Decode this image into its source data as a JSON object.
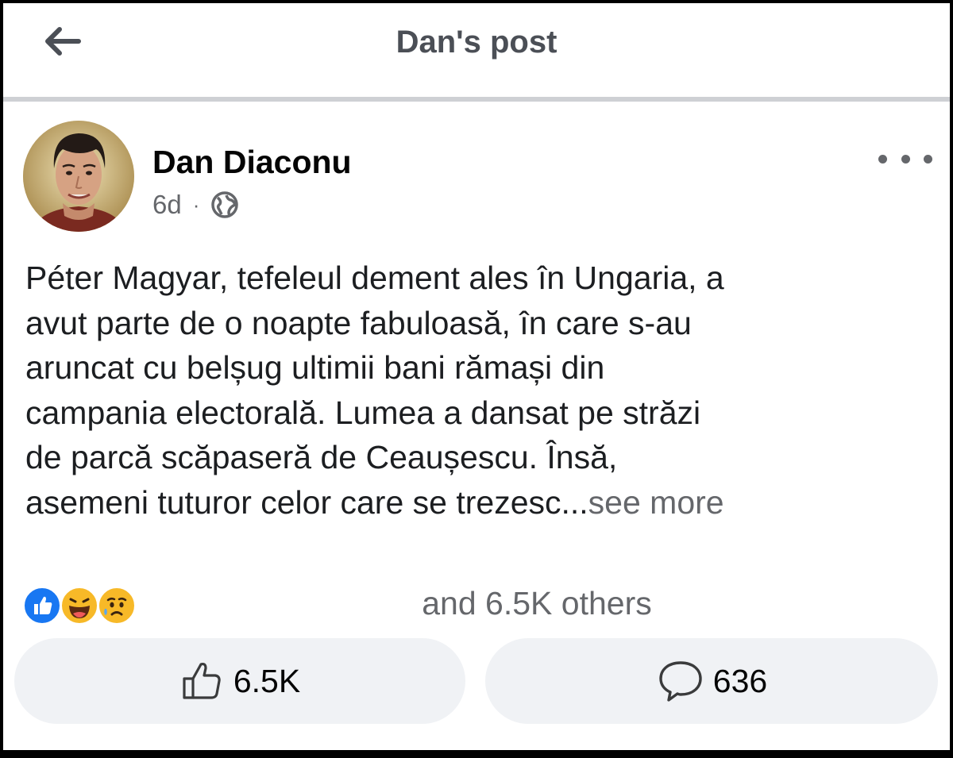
{
  "header": {
    "title": "Dan's post"
  },
  "post": {
    "author": "Dan Diaconu",
    "age": "6d",
    "separator": "·",
    "text_lines": [
      "Péter Magyar, tefeleul dement ales în Ungaria, a",
      "avut parte de o noapte fabuloasă, în care s-au",
      "aruncat cu belșug ultimii bani rămași din",
      "campania electorală. Lumea a dansat pe străzi",
      "de parcă scăpaseră de Ceaușescu. Însă,",
      "asemeni tuturor celor care se trezesc..."
    ],
    "see_more": "see more"
  },
  "reactions": {
    "icons": [
      "like-icon",
      "haha-icon",
      "sad-icon"
    ],
    "others_text": "and 6.5K others"
  },
  "actions": {
    "like_count": "6.5K",
    "comment_count": "636"
  },
  "colors": {
    "like_blue": "#1877f2",
    "emoji_yellow": "#f7b928",
    "secondary_text": "#65676b",
    "button_bg": "#f0f2f5"
  }
}
